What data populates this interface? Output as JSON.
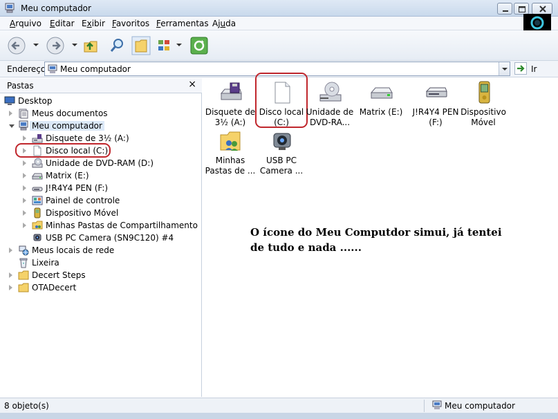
{
  "window": {
    "title": "Meu computador",
    "icon": "my-computer-icon"
  },
  "menu": [
    {
      "label": "Arquivo",
      "accel": "A",
      "rest": "rquivo"
    },
    {
      "label": "Editar",
      "accel": "E",
      "rest": "ditar"
    },
    {
      "label": "Exibir",
      "accel": "x",
      "pre": "E",
      "rest": "ibir"
    },
    {
      "label": "Favoritos",
      "accel": "F",
      "rest": "avoritos"
    },
    {
      "label": "Ferramentas",
      "accel": "F",
      "rest": "erramentas"
    },
    {
      "label": "Ajuda",
      "accel": "u",
      "pre": "Aj",
      "rest": "da"
    }
  ],
  "address": {
    "label": "Endereço",
    "value": "Meu computador",
    "go_label": "Ir"
  },
  "folders_pane": {
    "title": "Pastas",
    "close": "×",
    "tree": [
      {
        "label": "Desktop",
        "icon": "desktop-icon",
        "level": 0,
        "expander": "none"
      },
      {
        "label": "Meus documentos",
        "icon": "documents-icon",
        "level": 1,
        "expander": "collapsed"
      },
      {
        "label": "Meu computador",
        "icon": "my-computer-icon",
        "level": 1,
        "expander": "expanded",
        "selected": true
      },
      {
        "label": "Disquete de 3½ (A:)",
        "icon": "floppy-drive-icon",
        "level": 2,
        "expander": "collapsed"
      },
      {
        "label": "Disco local (C:)",
        "icon": "blank-file-icon",
        "level": 2,
        "expander": "collapsed",
        "circled": true
      },
      {
        "label": "Unidade de DVD-RAM (D:)",
        "icon": "dvd-drive-icon",
        "level": 2,
        "expander": "collapsed"
      },
      {
        "label": "Matrix (E:)",
        "icon": "hard-drive-icon",
        "level": 2,
        "expander": "collapsed"
      },
      {
        "label": "J!R4Y4 PEN (F:)",
        "icon": "removable-drive-icon",
        "level": 2,
        "expander": "collapsed"
      },
      {
        "label": "Painel de controle",
        "icon": "control-panel-icon",
        "level": 2,
        "expander": "collapsed"
      },
      {
        "label": "Dispositivo Móvel",
        "icon": "mobile-device-icon",
        "level": 2,
        "expander": "collapsed"
      },
      {
        "label": "Minhas Pastas de Compartilhamento",
        "icon": "shared-folder-icon",
        "level": 2,
        "expander": "collapsed"
      },
      {
        "label": "USB PC Camera (SN9C120) #4",
        "icon": "webcam-icon",
        "level": 2,
        "expander": "none"
      },
      {
        "label": "Meus locais de rede",
        "icon": "network-icon",
        "level": 1,
        "expander": "collapsed"
      },
      {
        "label": "Lixeira",
        "icon": "recycle-bin-icon",
        "level": 1,
        "expander": "none"
      },
      {
        "label": "Decert Steps",
        "icon": "folder-icon",
        "level": 1,
        "expander": "collapsed"
      },
      {
        "label": "OTADecert",
        "icon": "folder-icon",
        "level": 1,
        "expander": "collapsed"
      }
    ]
  },
  "items": [
    {
      "line1": "Disquete de",
      "line2": "3½ (A:)",
      "icon": "floppy-drive-icon"
    },
    {
      "line1": "Disco local",
      "line2": "(C:)",
      "icon": "blank-file-icon",
      "circled": true
    },
    {
      "line1": "Unidade de",
      "line2": "DVD-RA...",
      "icon": "dvd-drive-icon"
    },
    {
      "line1": "Matrix (E:)",
      "line2": "",
      "icon": "hard-drive-icon"
    },
    {
      "line1": "J!R4Y4 PEN",
      "line2": "(F:)",
      "icon": "removable-drive-icon"
    },
    {
      "line1": "Dispositivo",
      "line2": "Móvel",
      "icon": "mobile-device-icon"
    },
    {
      "line1": "Minhas",
      "line2": "Pastas de ...",
      "icon": "shared-folder-icon"
    },
    {
      "line1": "USB PC",
      "line2": "Camera ...",
      "icon": "webcam-icon"
    }
  ],
  "annotation": {
    "line1": "O ícone do Meu Computdor simui, já tentei",
    "line2": "de tudo e nada ......"
  },
  "status": {
    "count": "8 objeto(s)",
    "location": "Meu computador"
  },
  "colors": {
    "annotation_circle": "#c0262c",
    "selection": "#dbe8f7"
  }
}
